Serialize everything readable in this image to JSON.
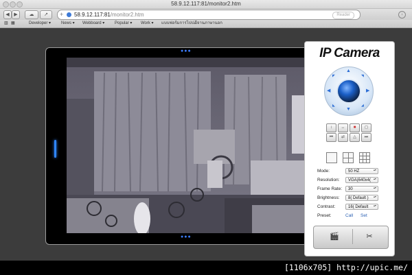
{
  "window": {
    "title": "58.9.12.117:81/monitor2.htm"
  },
  "toolbar": {
    "back_icon": "back-arrow-icon",
    "forward_icon": "forward-arrow-icon",
    "cloud_icon": "icloud-tabs-icon",
    "share_icon": "share-icon",
    "add_icon": "plus-icon",
    "url_host": "58.9.12.117:81",
    "url_path": "/monitor2.htm",
    "reader_label": "Reader",
    "download_icon": "download-icon"
  },
  "bookmarks": [
    {
      "label": "Developer ▾"
    },
    {
      "label": "News ▾"
    },
    {
      "label": "Webboard ▾"
    },
    {
      "label": "Popular ▾"
    },
    {
      "label": "Work ▾"
    },
    {
      "label": "แบบฟอร์มการไปป..."
    },
    {
      "label": "ดีจานภาษานอก"
    }
  ],
  "panel": {
    "logo": "IP Camera",
    "icons": [
      "flip-vertical-icon",
      "flip-horizontal-icon",
      "record-icon",
      "snapshot-icon",
      "prev-icon",
      "patrol-icon",
      "up-icon",
      "next-icon",
      "audio-icon",
      "talk-icon",
      "mic-icon",
      "ir-icon"
    ],
    "view_modes": [
      "single-view-icon",
      "quad-view-icon",
      "nine-view-icon"
    ],
    "settings": [
      {
        "label": "Mode:",
        "value": "50 HZ"
      },
      {
        "label": "Resolution:",
        "value": "VGA(640x4("
      },
      {
        "label": "Frame Rate:",
        "value": "30"
      },
      {
        "label": "Brightness:",
        "value": "8( Default )"
      },
      {
        "label": "Contrast:",
        "value": "16( Default"
      }
    ],
    "preset_label": "Preset:",
    "preset_call": "Call",
    "preset_set": "Set",
    "bottom_buttons": [
      "media-icon",
      "tools-icon"
    ]
  },
  "colors": {
    "accent": "#2f86ff",
    "page_bg": "#3c3c3c",
    "banner_bg": "#000000"
  },
  "footer": {
    "text": "[1106x705] http://upic.me/"
  }
}
